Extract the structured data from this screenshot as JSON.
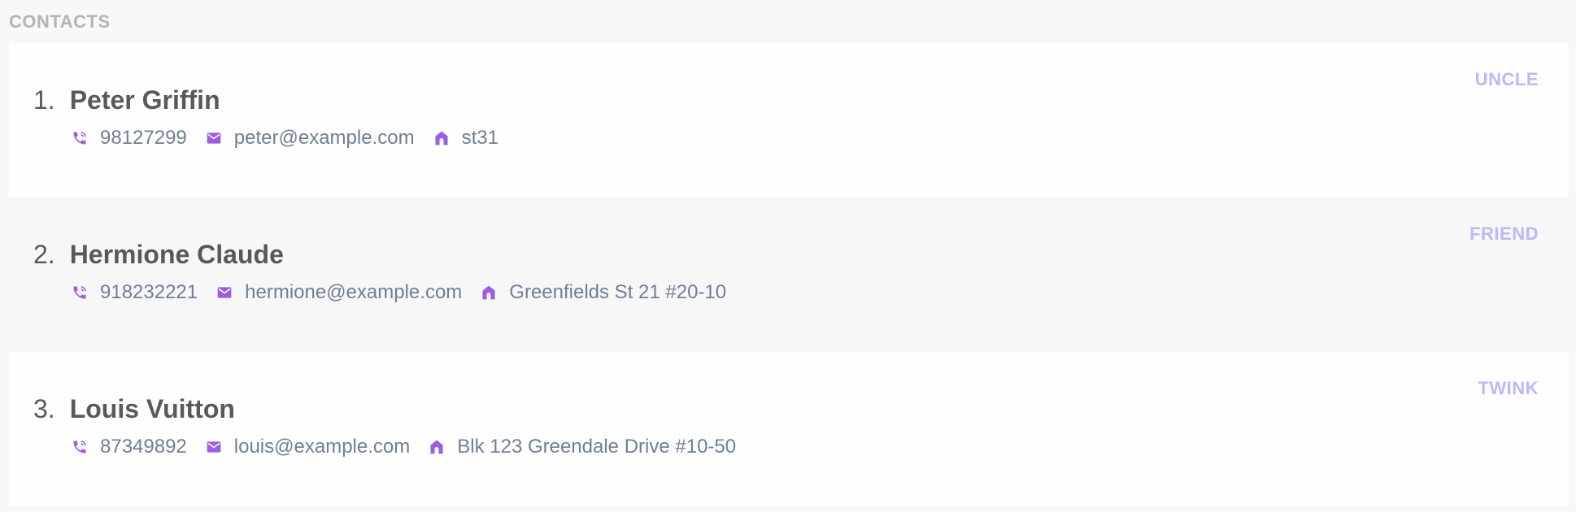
{
  "section": {
    "title": "CONTACTS"
  },
  "colors": {
    "accent_icon": "#9b5de5",
    "tag": "#b9b9fb",
    "name": "#595959",
    "detail_text": "#6f7f98",
    "section_title": "#b4b4b8"
  },
  "contacts": [
    {
      "index": "1.",
      "name": "Peter Griffin",
      "tag": "UNCLE",
      "phone": "98127299",
      "email": "peter@example.com",
      "address": "st31",
      "icons": [
        "phone-icon",
        "mail-icon",
        "home-icon"
      ]
    },
    {
      "index": "2.",
      "name": "Hermione Claude",
      "tag": "FRIEND",
      "phone": "918232221",
      "email": "hermione@example.com",
      "address": "Greenfields St 21 #20-10",
      "icons": [
        "phone-icon",
        "mail-icon",
        "home-icon"
      ]
    },
    {
      "index": "3.",
      "name": "Louis Vuitton",
      "tag": "TWINK",
      "phone": "87349892",
      "email": "louis@example.com",
      "address": "Blk 123 Greendale Drive #10-50",
      "icons": [
        "phone-icon",
        "mail-icon",
        "home-icon"
      ]
    }
  ]
}
